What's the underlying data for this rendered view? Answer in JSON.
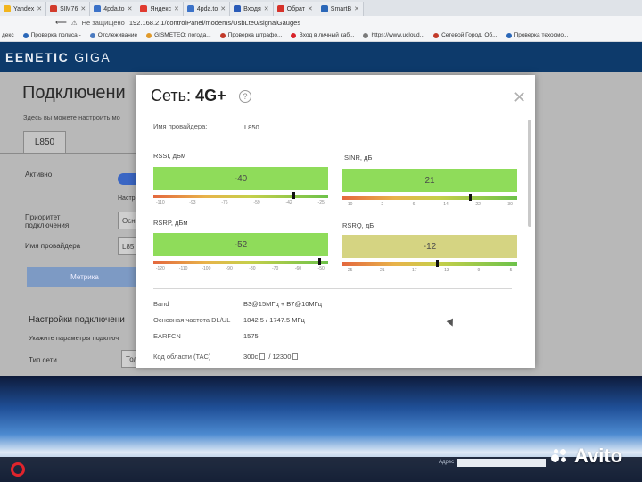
{
  "browser": {
    "tabs": [
      {
        "label": "Yandex",
        "color": "#f2b51d"
      },
      {
        "label": "SIM76",
        "color": "#d23b2c"
      },
      {
        "label": "4pda.to",
        "color": "#3b72c8"
      },
      {
        "label": "Яндекс",
        "color": "#e03a2f"
      },
      {
        "label": "4pda.to",
        "color": "#3b72c8"
      },
      {
        "label": "Входя",
        "color": "#2a5bb8"
      },
      {
        "label": "Обрат",
        "color": "#d6322a"
      },
      {
        "label": "SmartB",
        "color": "#2a67b8"
      }
    ],
    "security_label": "Не защищено",
    "url": "192.168.2.1/controlPanel/modems/UsbLte0/signalGauges",
    "bookmarks": [
      {
        "label": "Проверка полиса -",
        "color": "#2a67b8"
      },
      {
        "label": "Отслеживание",
        "color": "#4a7ac0"
      },
      {
        "label": "GISMETEO: погода...",
        "color": "#e09a2a"
      },
      {
        "label": "Проверка штрафо...",
        "color": "#c23a2a"
      },
      {
        "label": "Вход в личный каб...",
        "color": "#d8232a"
      },
      {
        "label": "https://www.ucloud...",
        "color": "#7a7a7a"
      },
      {
        "label": "Сетевой Город. Об...",
        "color": "#c23a2a"
      },
      {
        "label": "Проверка техосмо...",
        "color": "#2a67b8"
      }
    ],
    "bookmarks_prefix": "декс"
  },
  "app": {
    "brand": "EENETIC",
    "brand_suffix": "GIGA"
  },
  "page": {
    "title": "Подключени",
    "subtitle": "Здесь вы можете настроить мо",
    "tab_label": "L850",
    "active_label": "Активно",
    "settings_hint": "Настр",
    "priority_label_line1": "Приоритет",
    "priority_label_line2": "подключения",
    "priority_value": "Осн",
    "provider_label": "Имя провайдера",
    "provider_value": "L85",
    "metric_button": "Метрика",
    "section_title": "Настройки подключени",
    "section_hint": "Укажите параметры подключ",
    "network_type_label": "Тип сети",
    "network_type_value": "Тол"
  },
  "modal": {
    "title_prefix": "Сеть:",
    "title_network": "4G+",
    "help": "?",
    "provider_label": "Имя провайдера:",
    "provider_value": "L850",
    "metrics": [
      {
        "id": "rssi",
        "label": "RSSI, дБм",
        "value": "-40",
        "color": "#8fdc5a",
        "fraction": 0.8,
        "ticks": [
          "-110",
          "-93",
          "-76",
          "-59",
          "-42",
          "-25"
        ]
      },
      {
        "id": "sinr",
        "label": "SINR, дБ",
        "value": "21",
        "color": "#8fdc5a",
        "fraction": 0.73,
        "ticks": [
          "-10",
          "-2",
          "6",
          "14",
          "22",
          "30"
        ]
      },
      {
        "id": "rsrp",
        "label": "RSRP, дБм",
        "value": "-52",
        "color": "#8fdc5a",
        "fraction": 0.95,
        "ticks": [
          "-120",
          "-110",
          "-100",
          "-90",
          "-80",
          "-70",
          "-60",
          "-50"
        ]
      },
      {
        "id": "rsrq",
        "label": "RSRQ, дБ",
        "value": "-12",
        "color": "#d5d482",
        "fraction": 0.54,
        "ticks": [
          "-25",
          "-21",
          "-17",
          "-13",
          "-9",
          "-5"
        ]
      }
    ],
    "info": [
      {
        "label": "Band",
        "value": "B3@15МГц + B7@10МГц"
      },
      {
        "label": "Основная частота DL/UL",
        "value": "1842.5 / 1747.5 МГц"
      },
      {
        "label": "EARFCN",
        "value": "1575"
      },
      {
        "label": "Код области (TAC)",
        "value_a": "300c",
        "value_b": "12300"
      }
    ]
  },
  "taskbar": {
    "address_label": "Адрес"
  },
  "watermark": "Avito"
}
